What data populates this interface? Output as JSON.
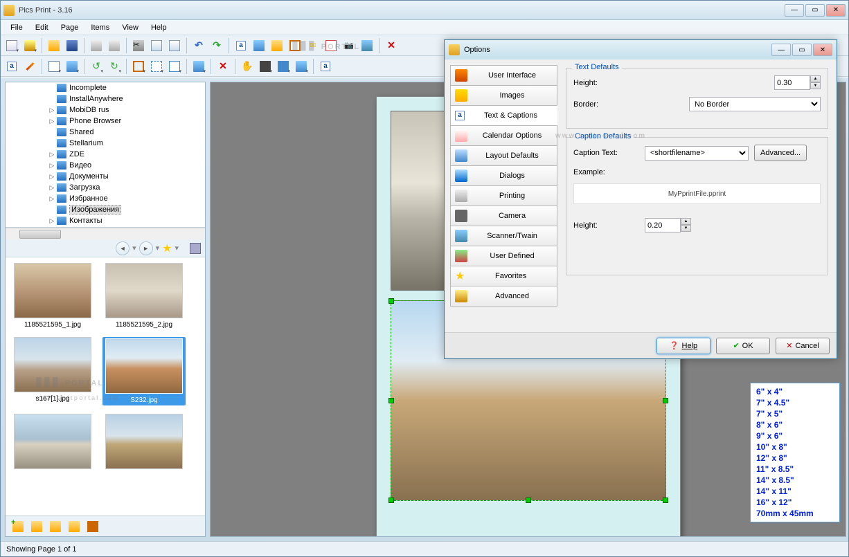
{
  "app": {
    "title": "Pics Print - 3.16"
  },
  "menu": [
    "File",
    "Edit",
    "Page",
    "Items",
    "View",
    "Help"
  ],
  "tree": [
    {
      "label": "Incomplete",
      "exp": ""
    },
    {
      "label": "InstallAnywhere",
      "exp": ""
    },
    {
      "label": "MobiDB rus",
      "exp": "▷"
    },
    {
      "label": "Phone Browser",
      "exp": "▷"
    },
    {
      "label": "Shared",
      "exp": ""
    },
    {
      "label": "Stellarium",
      "exp": ""
    },
    {
      "label": "ZDE",
      "exp": "▷"
    },
    {
      "label": "Видео",
      "exp": "▷"
    },
    {
      "label": "Документы",
      "exp": "▷"
    },
    {
      "label": "Загрузка",
      "exp": "▷"
    },
    {
      "label": "Избранное",
      "exp": "▷"
    },
    {
      "label": "Изображения",
      "exp": "",
      "sel": true
    },
    {
      "label": "Контакты",
      "exp": "▷"
    }
  ],
  "thumbs": [
    {
      "label": "1185521595_1.jpg"
    },
    {
      "label": "1185521595_2.jpg"
    },
    {
      "label": "s167[1].jpg"
    },
    {
      "label": "S232.jpg",
      "sel": true
    },
    {
      "label": ""
    },
    {
      "label": ""
    }
  ],
  "sizes": [
    "6\" x 4\"",
    "7\" x 4.5\"",
    "7\" x 5\"",
    "8\" x 6\"",
    "9\" x 6\"",
    "10\" x 8\"",
    "12\" x 8\"",
    "11\" x 8.5\"",
    "14\" x 8.5\"",
    "14\" x 11\"",
    "16\" x 12\"",
    "70mm x 45mm"
  ],
  "status": "Showing Page 1 of 1",
  "dialog": {
    "title": "Options",
    "tabs": [
      "User Interface",
      "Images",
      "Text & Captions",
      "Calendar Options",
      "Layout Defaults",
      "Dialogs",
      "Printing",
      "Camera",
      "Scanner/Twain",
      "User Defined",
      "Favorites",
      "Advanced"
    ],
    "text_defaults": {
      "legend": "Text Defaults",
      "height_label": "Height:",
      "height_value": "0.30",
      "border_label": "Border:",
      "border_value": "No Border"
    },
    "caption_defaults": {
      "legend": "Caption Defaults",
      "caption_label": "Caption Text:",
      "caption_value": "<shortfilename>",
      "advanced": "Advanced...",
      "example_label": "Example:",
      "example_value": "MyPprintFile.pprint",
      "height_label": "Height:",
      "height_value": "0.20"
    },
    "buttons": {
      "help": "Help",
      "ok": "OK",
      "cancel": "Cancel"
    }
  },
  "watermark": {
    "brand": "PORTAL",
    "url": "www.softportal.com"
  }
}
